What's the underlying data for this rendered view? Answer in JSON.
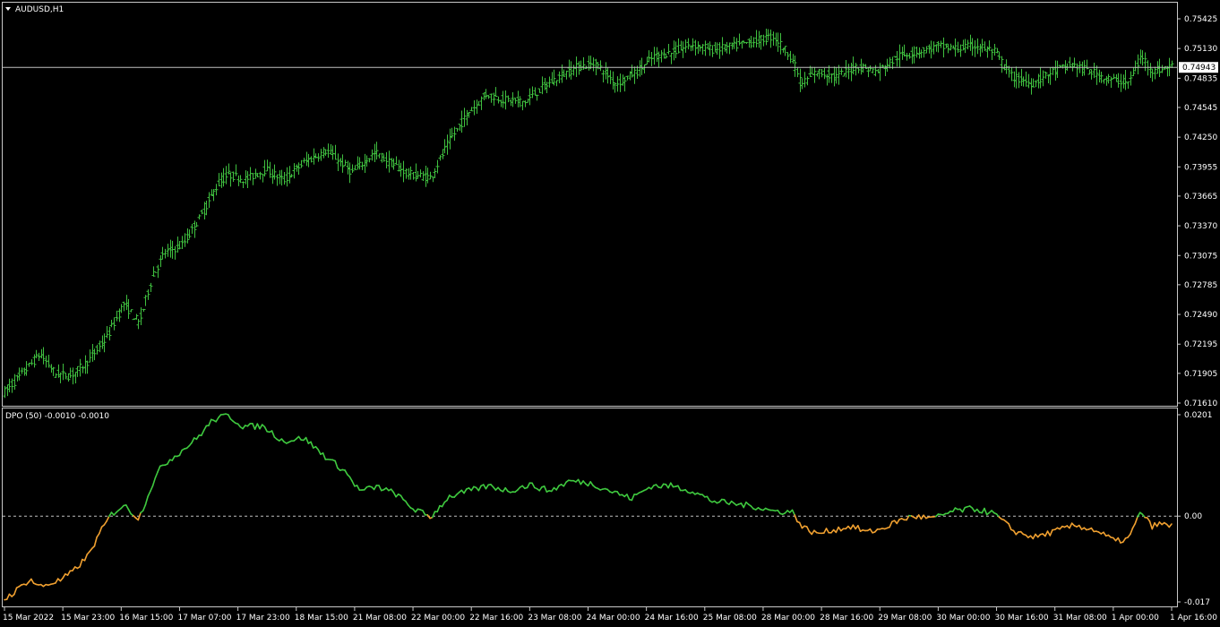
{
  "window": {
    "symbol_label": "AUDUSD,H1",
    "indicator_label": "DPO (50) -0.0010 -0.0010"
  },
  "colors": {
    "background": "#000000",
    "frame": "#c8c8c8",
    "bars": "#3fbf3f",
    "dpo_positive": "#3fc93f",
    "dpo_negative": "#f0a030",
    "level_line": "#c0c0c0"
  },
  "chart_data": [
    {
      "type": "ohlc",
      "name": "AUDUSD,H1",
      "ylim": [
        0.7161,
        0.75425
      ],
      "yticks": [
        "0.75425",
        "0.75130",
        "0.74835",
        "0.74545",
        "0.74250",
        "0.73955",
        "0.73665",
        "0.73370",
        "0.73075",
        "0.72785",
        "0.72490",
        "0.72195",
        "0.71905",
        "0.71610"
      ],
      "current_price": "0.74943",
      "anchors": [
        {
          "t": 0,
          "v": 0.7172
        },
        {
          "t": 8,
          "v": 0.7193
        },
        {
          "t": 14,
          "v": 0.721
        },
        {
          "t": 20,
          "v": 0.719
        },
        {
          "t": 26,
          "v": 0.7188
        },
        {
          "t": 33,
          "v": 0.7203
        },
        {
          "t": 40,
          "v": 0.7225
        },
        {
          "t": 47,
          "v": 0.726
        },
        {
          "t": 53,
          "v": 0.724
        },
        {
          "t": 58,
          "v": 0.7285
        },
        {
          "t": 63,
          "v": 0.731
        },
        {
          "t": 70,
          "v": 0.7318
        },
        {
          "t": 77,
          "v": 0.7345
        },
        {
          "t": 84,
          "v": 0.7378
        },
        {
          "t": 88,
          "v": 0.7388
        },
        {
          "t": 95,
          "v": 0.7383
        },
        {
          "t": 103,
          "v": 0.7393
        },
        {
          "t": 110,
          "v": 0.7382
        },
        {
          "t": 118,
          "v": 0.74
        },
        {
          "t": 127,
          "v": 0.7412
        },
        {
          "t": 137,
          "v": 0.739
        },
        {
          "t": 146,
          "v": 0.741
        },
        {
          "t": 153,
          "v": 0.7398
        },
        {
          "t": 160,
          "v": 0.7388
        },
        {
          "t": 168,
          "v": 0.7385
        },
        {
          "t": 175,
          "v": 0.742
        },
        {
          "t": 183,
          "v": 0.745
        },
        {
          "t": 190,
          "v": 0.7468
        },
        {
          "t": 197,
          "v": 0.7462
        },
        {
          "t": 205,
          "v": 0.746
        },
        {
          "t": 212,
          "v": 0.7474
        },
        {
          "t": 219,
          "v": 0.7486
        },
        {
          "t": 226,
          "v": 0.7495
        },
        {
          "t": 233,
          "v": 0.7498
        },
        {
          "t": 241,
          "v": 0.7478
        },
        {
          "t": 249,
          "v": 0.749
        },
        {
          "t": 256,
          "v": 0.7505
        },
        {
          "t": 264,
          "v": 0.751
        },
        {
          "t": 271,
          "v": 0.7517
        },
        {
          "t": 279,
          "v": 0.7512
        },
        {
          "t": 287,
          "v": 0.7515
        },
        {
          "t": 295,
          "v": 0.752
        },
        {
          "t": 303,
          "v": 0.7525
        },
        {
          "t": 310,
          "v": 0.7505
        },
        {
          "t": 314,
          "v": 0.7478
        },
        {
          "t": 320,
          "v": 0.749
        },
        {
          "t": 328,
          "v": 0.7485
        },
        {
          "t": 336,
          "v": 0.7496
        },
        {
          "t": 344,
          "v": 0.749
        },
        {
          "t": 352,
          "v": 0.7505
        },
        {
          "t": 360,
          "v": 0.751
        },
        {
          "t": 368,
          "v": 0.7515
        },
        {
          "t": 375,
          "v": 0.7513
        },
        {
          "t": 383,
          "v": 0.7516
        },
        {
          "t": 390,
          "v": 0.751
        },
        {
          "t": 397,
          "v": 0.7485
        },
        {
          "t": 405,
          "v": 0.7478
        },
        {
          "t": 413,
          "v": 0.749
        },
        {
          "t": 421,
          "v": 0.7497
        },
        {
          "t": 428,
          "v": 0.749
        },
        {
          "t": 436,
          "v": 0.7482
        },
        {
          "t": 443,
          "v": 0.7479
        },
        {
          "t": 448,
          "v": 0.7505
        },
        {
          "t": 453,
          "v": 0.749
        },
        {
          "t": 459,
          "v": 0.7495
        }
      ]
    },
    {
      "type": "line",
      "name": "DPO (50)",
      "ylim": [
        -0.017,
        0.0201
      ],
      "yticks": [
        "0.0201",
        "0.00",
        "-0.017"
      ],
      "level": 0.0,
      "level_label": "0.00",
      "anchors": [
        {
          "t": 0,
          "v": -0.0165
        },
        {
          "t": 4,
          "v": -0.015
        },
        {
          "t": 10,
          "v": -0.0125
        },
        {
          "t": 14,
          "v": -0.014
        },
        {
          "t": 22,
          "v": -0.0127
        },
        {
          "t": 27,
          "v": -0.011
        },
        {
          "t": 33,
          "v": -0.0078
        },
        {
          "t": 38,
          "v": -0.003
        },
        {
          "t": 42,
          "v": 0.0003
        },
        {
          "t": 47,
          "v": 0.0022
        },
        {
          "t": 53,
          "v": -0.0005
        },
        {
          "t": 58,
          "v": 0.006
        },
        {
          "t": 62,
          "v": 0.01
        },
        {
          "t": 70,
          "v": 0.013
        },
        {
          "t": 76,
          "v": 0.0155
        },
        {
          "t": 82,
          "v": 0.019
        },
        {
          "t": 88,
          "v": 0.02
        },
        {
          "t": 94,
          "v": 0.0178
        },
        {
          "t": 102,
          "v": 0.0178
        },
        {
          "t": 110,
          "v": 0.0148
        },
        {
          "t": 118,
          "v": 0.0155
        },
        {
          "t": 126,
          "v": 0.012
        },
        {
          "t": 134,
          "v": 0.009
        },
        {
          "t": 140,
          "v": 0.005
        },
        {
          "t": 147,
          "v": 0.0058
        },
        {
          "t": 154,
          "v": 0.0045
        },
        {
          "t": 161,
          "v": 0.0015
        },
        {
          "t": 168,
          "v": -0.0002
        },
        {
          "t": 175,
          "v": 0.0038
        },
        {
          "t": 183,
          "v": 0.005
        },
        {
          "t": 191,
          "v": 0.006
        },
        {
          "t": 199,
          "v": 0.005
        },
        {
          "t": 207,
          "v": 0.0062
        },
        {
          "t": 215,
          "v": 0.005
        },
        {
          "t": 223,
          "v": 0.007
        },
        {
          "t": 231,
          "v": 0.0065
        },
        {
          "t": 239,
          "v": 0.005
        },
        {
          "t": 247,
          "v": 0.0035
        },
        {
          "t": 255,
          "v": 0.006
        },
        {
          "t": 263,
          "v": 0.006
        },
        {
          "t": 271,
          "v": 0.005
        },
        {
          "t": 279,
          "v": 0.003
        },
        {
          "t": 287,
          "v": 0.0025
        },
        {
          "t": 295,
          "v": 0.002
        },
        {
          "t": 303,
          "v": 0.001
        },
        {
          "t": 311,
          "v": 0.0008
        },
        {
          "t": 314,
          "v": -0.002
        },
        {
          "t": 320,
          "v": -0.0035
        },
        {
          "t": 326,
          "v": -0.0028
        },
        {
          "t": 334,
          "v": -0.002
        },
        {
          "t": 340,
          "v": -0.0032
        },
        {
          "t": 346,
          "v": -0.0025
        },
        {
          "t": 352,
          "v": -0.001
        },
        {
          "t": 358,
          "v": 0.0
        },
        {
          "t": 366,
          "v": -0.0005
        },
        {
          "t": 374,
          "v": 0.001
        },
        {
          "t": 382,
          "v": 0.0015
        },
        {
          "t": 390,
          "v": 0.0005
        },
        {
          "t": 398,
          "v": -0.003
        },
        {
          "t": 406,
          "v": -0.0042
        },
        {
          "t": 414,
          "v": -0.003
        },
        {
          "t": 422,
          "v": -0.0018
        },
        {
          "t": 430,
          "v": -0.0028
        },
        {
          "t": 438,
          "v": -0.005
        },
        {
          "t": 443,
          "v": -0.0045
        },
        {
          "t": 448,
          "v": 0.001
        },
        {
          "t": 452,
          "v": -0.002
        },
        {
          "t": 456,
          "v": -0.0015
        },
        {
          "t": 459,
          "v": -0.002
        }
      ]
    }
  ],
  "time_axis": {
    "labels": [
      {
        "bar": 0,
        "text": "15 Mar 2022"
      },
      {
        "bar": 24,
        "text": "15 Mar 23:00"
      },
      {
        "bar": 48,
        "text": "16 Mar 15:00"
      },
      {
        "bar": 72,
        "text": "17 Mar 07:00"
      },
      {
        "bar": 96,
        "text": "17 Mar 23:00"
      },
      {
        "bar": 120,
        "text": "18 Mar 15:00"
      },
      {
        "bar": 144,
        "text": "21 Mar 08:00"
      },
      {
        "bar": 168,
        "text": "22 Mar 00:00"
      },
      {
        "bar": 192,
        "text": "22 Mar 16:00"
      },
      {
        "bar": 216,
        "text": "23 Mar 08:00"
      },
      {
        "bar": 240,
        "text": "24 Mar 00:00"
      },
      {
        "bar": 264,
        "text": "24 Mar 16:00"
      },
      {
        "bar": 288,
        "text": "25 Mar 08:00"
      },
      {
        "bar": 312,
        "text": "28 Mar 00:00"
      },
      {
        "bar": 336,
        "text": "28 Mar 16:00"
      },
      {
        "bar": 360,
        "text": "29 Mar 08:00"
      },
      {
        "bar": 384,
        "text": "30 Mar 00:00"
      },
      {
        "bar": 408,
        "text": "30 Mar 16:00"
      },
      {
        "bar": 432,
        "text": "31 Mar 08:00"
      },
      {
        "bar": 456,
        "text": "1 Apr 00:00"
      },
      {
        "bar": 480,
        "text": "1 Apr 16:00"
      }
    ]
  }
}
